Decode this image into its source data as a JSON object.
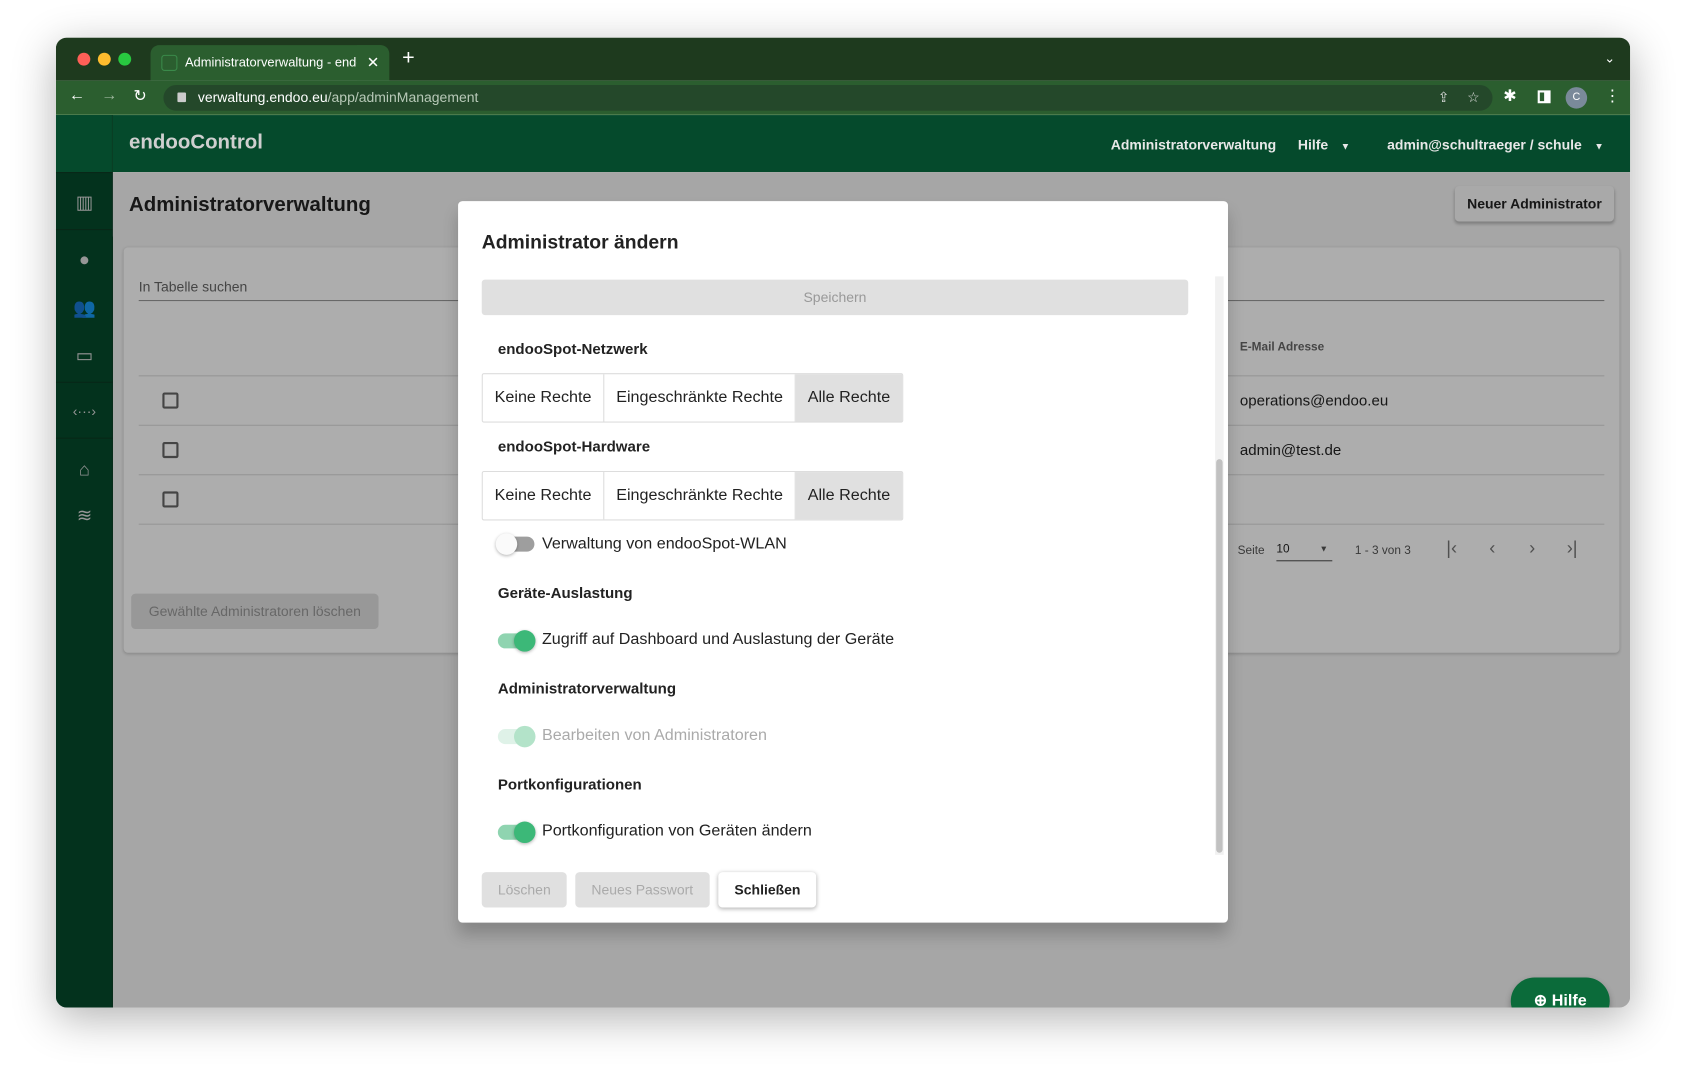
{
  "browser": {
    "tab_title": "Administratorverwaltung - endoo",
    "url_host": "verwaltung.endoo.eu",
    "url_path": "/app/adminManagement",
    "profile_initial": "C"
  },
  "app": {
    "name": "endooControl",
    "nav": {
      "admin": "Administratorverwaltung",
      "help": "Hilfe",
      "user": "admin@schultraeger / schule"
    }
  },
  "page": {
    "title": "Administratorverwaltung",
    "new_button": "Neuer Administrator",
    "search_placeholder": "In Tabelle suchen",
    "column_email": "E-Mail Adresse",
    "rows": [
      {
        "email": "operations@endoo.eu"
      },
      {
        "email": "admin@test.de"
      },
      {
        "email": ""
      }
    ],
    "delete_selected": "Gewählte Administratoren löschen",
    "pagination": {
      "per_page_label": "Seite",
      "per_page": "10",
      "range": "1 - 3 von 3"
    }
  },
  "modal": {
    "title": "Administrator ändern",
    "save": "Speichern",
    "sections": [
      {
        "title": "endooSpot-Netzwerk",
        "options": [
          "Keine Rechte",
          "Eingeschränkte Rechte",
          "Alle Rechte"
        ],
        "selected": "Alle Rechte"
      },
      {
        "title": "endooSpot-Hardware",
        "options": [
          "Keine Rechte",
          "Eingeschränkte Rechte",
          "Alle Rechte"
        ],
        "selected": "Alle Rechte"
      }
    ],
    "wlan_toggle": {
      "label": "Verwaltung von endooSpot-WLAN",
      "on": false
    },
    "devices": {
      "title": "Geräte-Auslastung",
      "toggle": "Zugriff auf Dashboard und Auslastung der Geräte",
      "on": true
    },
    "admins": {
      "title": "Administratorverwaltung",
      "toggle": "Bearbeiten von Administratoren",
      "on": true,
      "disabled": true
    },
    "ports": {
      "title": "Portkonfigurationen",
      "toggle": "Portkonfiguration von Geräten ändern",
      "on": true
    },
    "buttons": {
      "delete": "Löschen",
      "new_password": "Neues Passwort",
      "close": "Schließen"
    }
  },
  "fab": {
    "label": "Hilfe"
  },
  "colors": {
    "brand": "#054a2c",
    "toggle_on": "#3cb878"
  }
}
